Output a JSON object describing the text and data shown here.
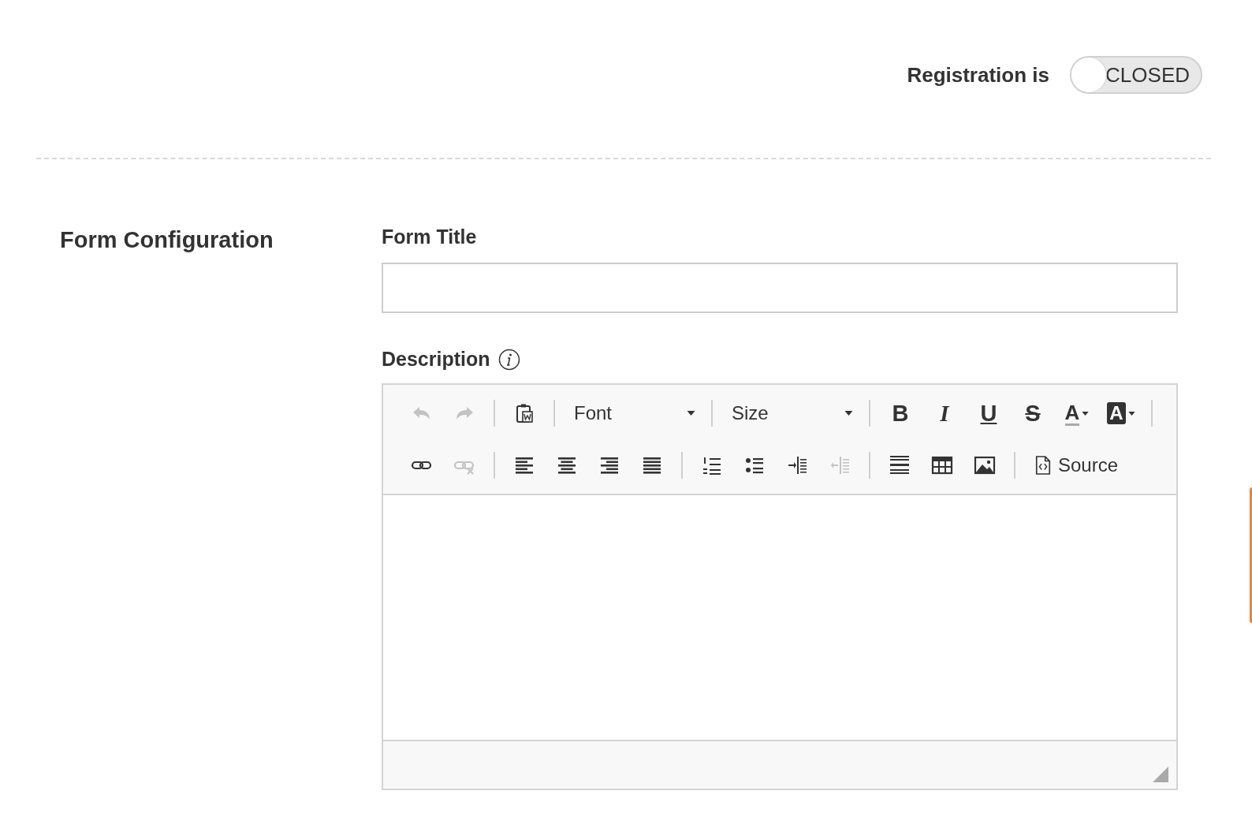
{
  "registration": {
    "label": "Registration is",
    "toggle": {
      "on": false,
      "text": "CLOSED"
    }
  },
  "section": {
    "title": "Form Configuration"
  },
  "form_title": {
    "label": "Form Title"
  },
  "description": {
    "label": "Description",
    "toolbar": {
      "rows": [
        [
          {
            "kind": "icon",
            "disabled": true
          },
          {
            "kind": "icon",
            "disabled": true
          },
          {
            "kind": "sep"
          },
          {
            "kind": "icon",
            "disabled": false
          },
          {
            "kind": "sep"
          },
          {
            "kind": "dropdown",
            "label": "Font"
          },
          {
            "kind": "sep"
          },
          {
            "kind": "dropdown",
            "label": "Size"
          },
          {
            "kind": "sep"
          },
          {
            "kind": "glyph",
            "text": "B"
          },
          {
            "kind": "glyph",
            "text": "I"
          },
          {
            "kind": "glyph",
            "text": "U"
          },
          {
            "kind": "glyph",
            "text": "S"
          },
          {
            "kind": "glyph",
            "text": "A"
          },
          {
            "kind": "glyph",
            "text": "A"
          },
          {
            "kind": "sep"
          }
        ],
        [
          {
            "kind": "icon",
            "disabled": false
          },
          {
            "kind": "icon",
            "disabled": true
          },
          {
            "kind": "sep"
          },
          {
            "kind": "icon",
            "disabled": false
          },
          {
            "kind": "icon",
            "disabled": false
          },
          {
            "kind": "icon",
            "disabled": false
          },
          {
            "kind": "icon",
            "disabled": false
          },
          {
            "kind": "sep"
          },
          {
            "kind": "icon",
            "disabled": false
          },
          {
            "kind": "icon",
            "disabled": false
          },
          {
            "kind": "icon",
            "disabled": false
          },
          {
            "kind": "icon",
            "disabled": true
          },
          {
            "kind": "sep"
          },
          {
            "kind": "icon",
            "disabled": false
          },
          {
            "kind": "icon",
            "disabled": false
          },
          {
            "kind": "icon",
            "disabled": false
          },
          {
            "kind": "sep"
          },
          {
            "kind": "button",
            "label": "Source"
          }
        ]
      ]
    }
  }
}
